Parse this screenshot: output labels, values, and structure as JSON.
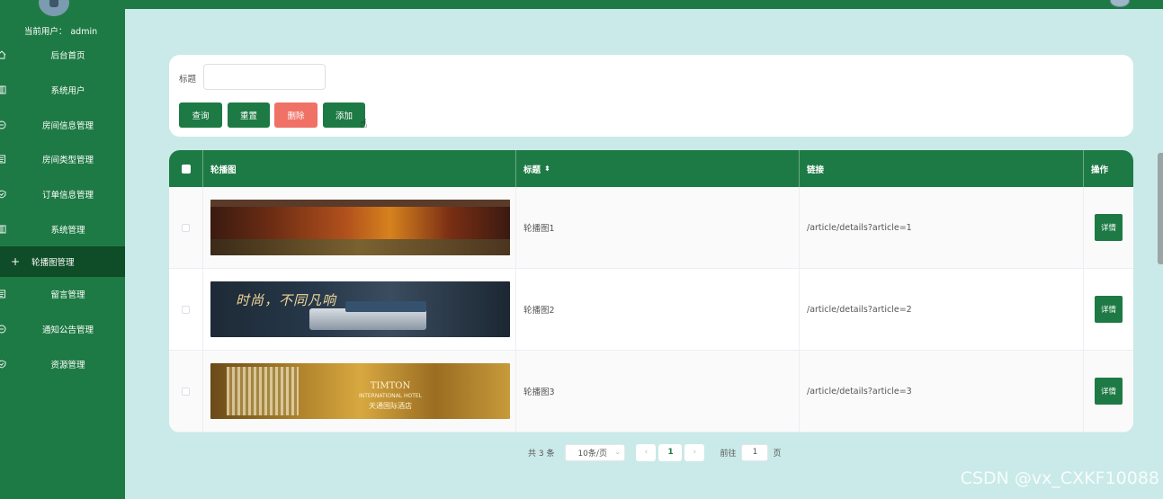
{
  "sidebar": {
    "user_label": "当前用户：",
    "username": "admin",
    "items": [
      {
        "label": "后台首页",
        "icon": "home-icon"
      },
      {
        "label": "系统用户",
        "icon": "columns-icon"
      },
      {
        "label": "房间信息管理",
        "icon": "chat-icon"
      },
      {
        "label": "房间类型管理",
        "icon": "document-icon"
      },
      {
        "label": "订单信息管理",
        "icon": "shield-check-icon"
      },
      {
        "label": "系统管理",
        "icon": "columns-icon"
      },
      {
        "label": "轮播图管理",
        "icon": "plus-icon",
        "active": true
      },
      {
        "label": "留言管理",
        "icon": "document-icon"
      },
      {
        "label": "通知公告管理",
        "icon": "chat-icon"
      },
      {
        "label": "资源管理",
        "icon": "shield-check-icon"
      }
    ]
  },
  "filter": {
    "title_label": "标题",
    "title_value": "",
    "buttons": {
      "search": "查询",
      "reset": "重置",
      "delete": "删除",
      "add": "添加"
    }
  },
  "table": {
    "headers": {
      "image": "轮播图",
      "title": "标题",
      "link": "链接",
      "action": "操作"
    },
    "rows": [
      {
        "title": "轮播图1",
        "link": "/article/details?article=1",
        "action": "详情"
      },
      {
        "title": "轮播图2",
        "link": "/article/details?article=2",
        "action": "详情",
        "banner_text": "时尚，不同凡响"
      },
      {
        "title": "轮播图3",
        "link": "/article/details?article=3",
        "action": "详情",
        "banner_brand": "TIMTON",
        "banner_sub": "INTERNATIONAL HOTEL",
        "banner_cn": "天通国际酒店"
      }
    ]
  },
  "pagination": {
    "total": "共 3 条",
    "page_size": "10条/页",
    "current_page": "1",
    "goto_label": "前往",
    "goto_value": "1",
    "page_suffix": "页"
  },
  "watermark": "CSDN @vx_CXKF10088",
  "colors": {
    "primary": "#1e7a44",
    "danger": "#f07166",
    "background": "#c9eae8",
    "sidebar_active": "#0e4d27"
  }
}
